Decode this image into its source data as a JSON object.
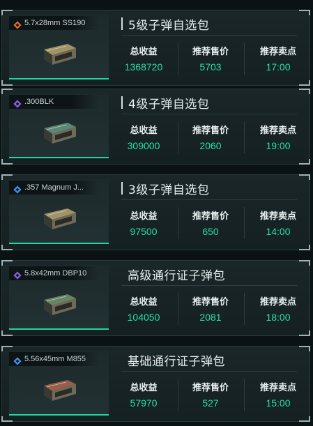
{
  "stat_labels": {
    "revenue": "总收益",
    "price": "推荐售价",
    "time": "推荐卖点"
  },
  "cards": [
    {
      "item": "5.7x28mm SS190",
      "rarity_icon": "orange-diamond-icon",
      "title": "5级子弹自选包",
      "title_bar": true,
      "revenue": "1368720",
      "price": "5703",
      "time": "17:00"
    },
    {
      "item": ".300BLK",
      "rarity_icon": "purple-diamond-icon",
      "title": "4级子弹自选包",
      "title_bar": true,
      "revenue": "309000",
      "price": "2060",
      "time": "19:00"
    },
    {
      "item": ".357 Magnum J...",
      "rarity_icon": "blue-diamond-icon",
      "title": "3级子弹自选包",
      "title_bar": true,
      "revenue": "97500",
      "price": "650",
      "time": "14:00"
    },
    {
      "item": "5.8x42mm DBP10",
      "rarity_icon": "purple-diamond-icon",
      "title": "高级通行证子弹包",
      "title_bar": false,
      "revenue": "104050",
      "price": "2081",
      "time": "18:00"
    },
    {
      "item": "5.56x45mm M855",
      "rarity_icon": "blue-diamond-icon",
      "title": "基础通行证子弹包",
      "title_bar": false,
      "revenue": "57970",
      "price": "527",
      "time": "15:00"
    }
  ],
  "colors": {
    "accent": "#1fd7a0",
    "value": "#28e0a4",
    "orange": "#e0672c",
    "purple": "#8a5cd8",
    "blue": "#3f8fe0"
  }
}
